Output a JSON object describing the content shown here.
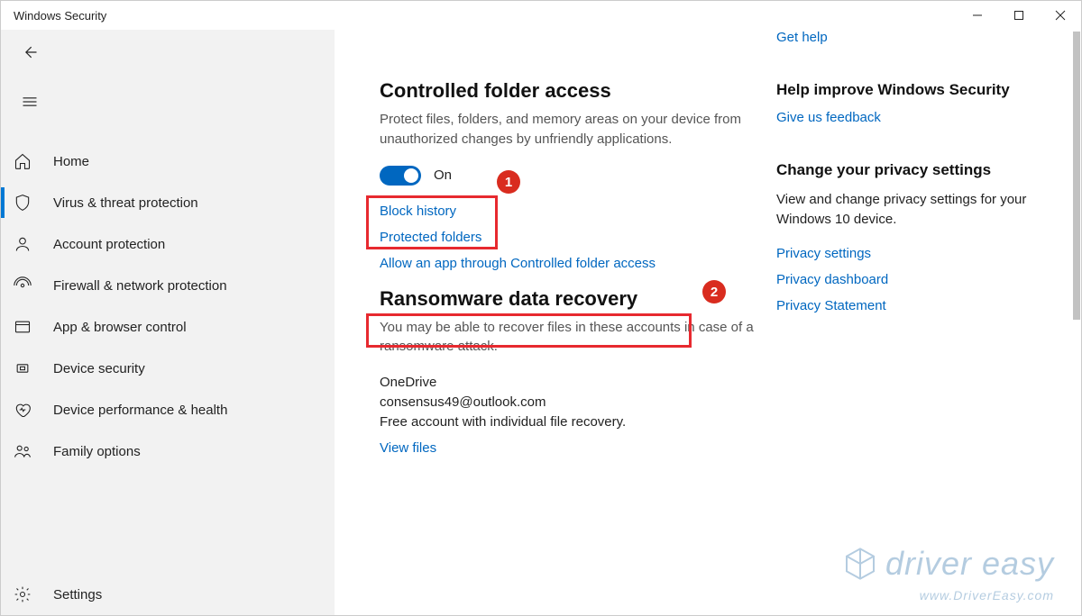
{
  "window": {
    "title": "Windows Security"
  },
  "sidebar": {
    "items": [
      {
        "label": "Home"
      },
      {
        "label": "Virus & threat protection"
      },
      {
        "label": "Account protection"
      },
      {
        "label": "Firewall & network protection"
      },
      {
        "label": "App & browser control"
      },
      {
        "label": "Device security"
      },
      {
        "label": "Device performance & health"
      },
      {
        "label": "Family options"
      }
    ],
    "settings": "Settings"
  },
  "main": {
    "cfa": {
      "title": "Controlled folder access",
      "description": "Protect files, folders, and memory areas on your device from unauthorized changes by unfriendly applications.",
      "toggle_state": "On",
      "link_block_history": "Block history",
      "link_protected_folders": "Protected folders",
      "link_allow_app": "Allow an app through Controlled folder access"
    },
    "recovery": {
      "title": "Ransomware data recovery",
      "description": "You may be able to recover files in these accounts in case of a ransomware attack.",
      "account_name": "OneDrive",
      "account_email": "consensus49@outlook.com",
      "account_note": "Free account with individual file recovery.",
      "link_view_files": "View files"
    }
  },
  "right": {
    "get_help": "Get help",
    "improve_title": "Help improve Windows Security",
    "feedback_link": "Give us feedback",
    "privacy_title": "Change your privacy settings",
    "privacy_desc": "View and change privacy settings for your Windows 10 device.",
    "link_privacy_settings": "Privacy settings",
    "link_privacy_dashboard": "Privacy dashboard",
    "link_privacy_statement": "Privacy Statement"
  },
  "annotations": {
    "badge1": "1",
    "badge2": "2"
  },
  "watermark": {
    "brand": "driver easy",
    "url": "www.DriverEasy.com"
  }
}
